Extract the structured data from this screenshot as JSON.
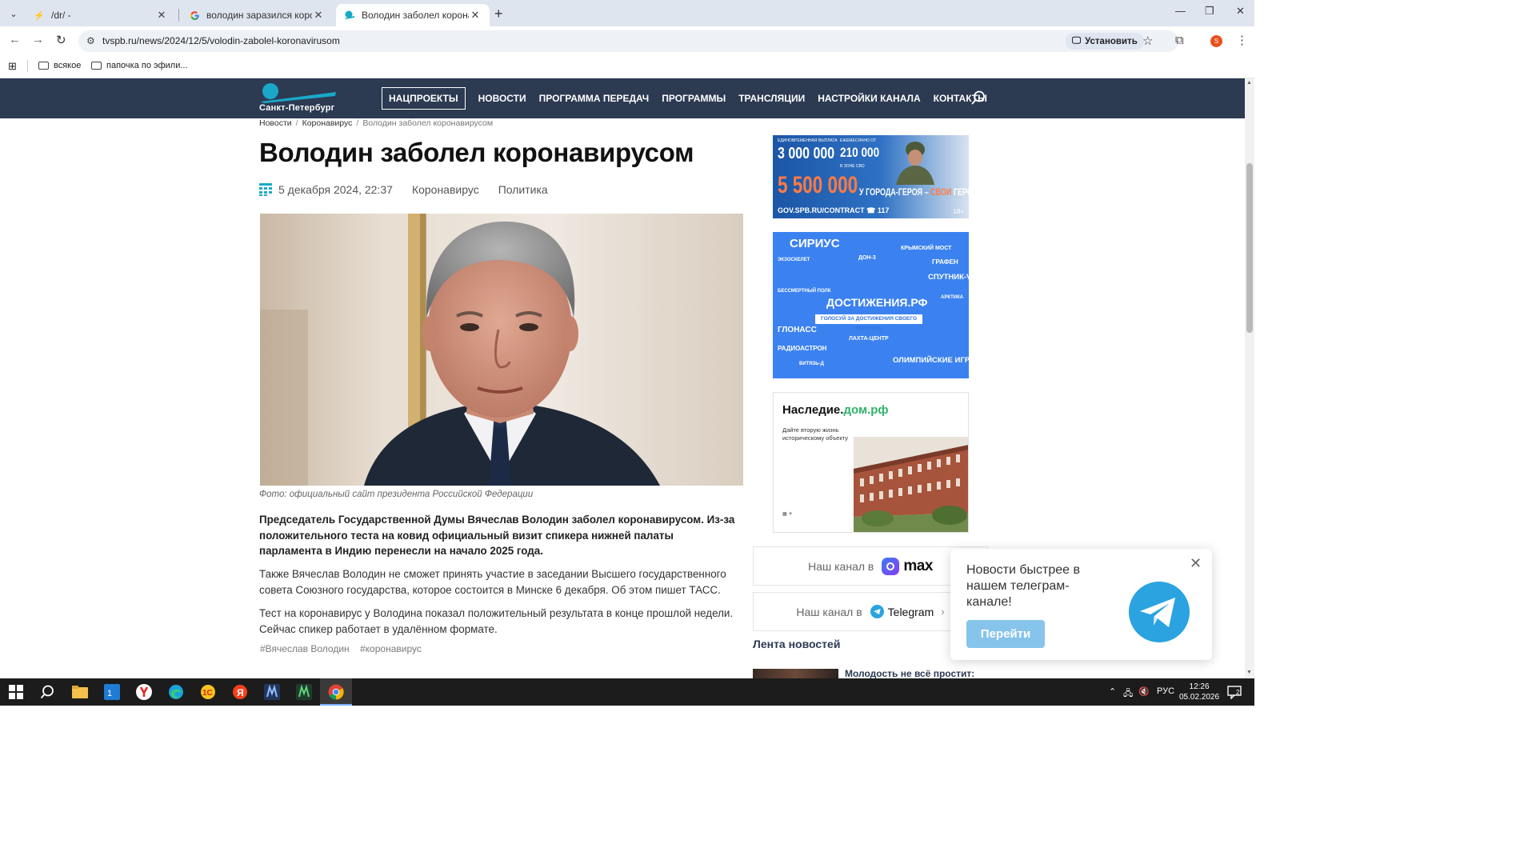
{
  "browser": {
    "tabs": [
      {
        "title": "/dr/ -"
      },
      {
        "title": "володин заразился коронавир"
      },
      {
        "title": "Володин заболел коронавиру"
      }
    ],
    "url": "tvspb.ru/news/2024/12/5/volodin-zabolel-koronavirusom",
    "install_label": "Установить",
    "bookmarks": [
      {
        "label": "всякое"
      },
      {
        "label": "папочка по эфили..."
      }
    ]
  },
  "site": {
    "logo_text": "Санкт-Петербург",
    "nav": [
      {
        "label": "НАЦПРОЕКТЫ"
      },
      {
        "label": "НОВОСТИ"
      },
      {
        "label": "ПРОГРАММА ПЕРЕДАЧ"
      },
      {
        "label": "ПРОГРАММЫ"
      },
      {
        "label": "ТРАНСЛЯЦИИ"
      },
      {
        "label": "НАСТРОЙКИ КАНАЛА"
      },
      {
        "label": "КОНТАКТЫ"
      }
    ]
  },
  "article": {
    "breadcrumb": [
      "Новости",
      "Коронавирус",
      "Володин заболел коронавирусом"
    ],
    "title": "Володин заболел коронавирусом",
    "date": "5 декабря 2024, 22:37",
    "categories": [
      "Коронавирус",
      "Политика"
    ],
    "photo_caption": "Фото: официальный сайт президента Российской Федерации",
    "lead": "Председатель Государственной Думы Вячеслав Володин заболел коронавирусом. Из-за положительного теста на ковид официальный визит спикера нижней палаты парламента в Индию перенесли на начало 2025 года.",
    "paragraphs": [
      "Также Вячеслав Володин не сможет принять участие в заседании Высшего государственного совета Союзного государства, которое состоится в Минске 6 декабря. Об этом пишет ТАСС.",
      "Тест на коронавирус у Володина показал положительный результата в конце прошлой недели. Сейчас спикер работает в удалённом формате."
    ],
    "tags": [
      "#Вячеслав Володин",
      "#коронавирус"
    ]
  },
  "sidebar": {
    "banner_army": {
      "line1": "ЕДИНОВРЕМЕННАЯ ВЫПЛАТА",
      "amount1": "3 000 000",
      "line2": "ЕЖЕМЕСЯЧНО ОТ",
      "amount2": "210 000",
      "line2b": "В ЗОНЕ СВО",
      "amount3": "5 500 000",
      "slogan_a": "У ГОРОДА-ГЕРОЯ – ",
      "slogan_b": "СВОИ",
      "slogan_c": " ГЕРОИ",
      "footer": "GOV.SPB.RU/CONTRACT  ☎ 117",
      "age": "18+"
    },
    "banner_dost": {
      "words": [
        "СИРИУС",
        "КРЫМСКИЙ МОСТ",
        "ЭКЗОСКЕЛЕТ",
        "ДОН-3",
        "ГРАФЕН",
        "СПУТНИК-V",
        "БЕССМЕРТНЫЙ ПОЛК",
        "ДОСТИЖЕНИЯ.РФ",
        "АРКТИКА",
        "ГЛОНАСС",
        "ЛАХТА-ЦЕНТР",
        "РАДИОАСТРОН",
        "ВИТЯЗЬ-Д",
        "ОЛИМПИЙСКИЕ ИГРЫ"
      ],
      "subtitle": "ГОЛОСУЙ ЗА ДОСТИЖЕНИЯ СВОЕГО РЕГИОНА"
    },
    "banner_nasl": {
      "title_a": "Наследие.",
      "title_b": "дом.рф",
      "desc": "Дайте вторую жизнь историческому объекту"
    },
    "channels": [
      {
        "prefix": "Наш канал в",
        "brand": "max"
      },
      {
        "prefix": "Наш канал в",
        "brand": "Telegram"
      }
    ],
    "feed_title": "Лента новостей",
    "feed_first": "Молодость не всё простит:"
  },
  "popup": {
    "text": "Новости быстрее в нашем телеграм-канале!",
    "button": "Перейти"
  },
  "taskbar": {
    "lang": "РУС",
    "time": "12:26",
    "date": "05.02.2026",
    "notifications": "2"
  },
  "colors": {
    "header_bg": "#2c3a52",
    "accent_teal": "#19a8c9",
    "telegram_blue": "#2aa3e0"
  }
}
